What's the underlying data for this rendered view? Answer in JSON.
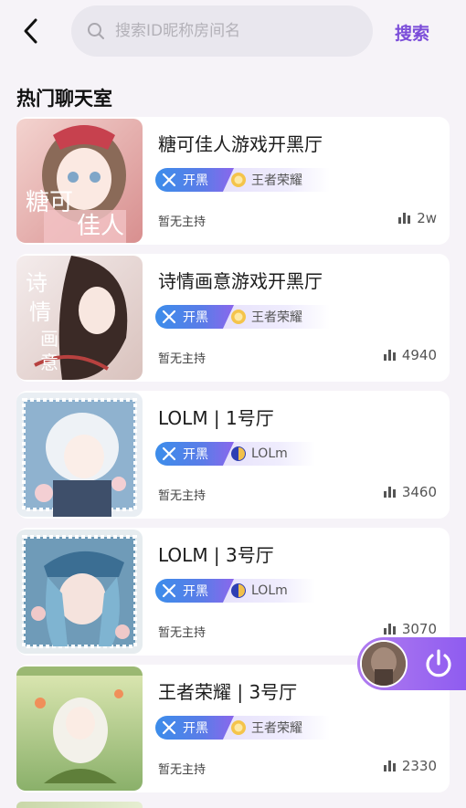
{
  "header": {
    "search_placeholder": "搜索ID昵称房间名",
    "search_button": "搜索"
  },
  "section_title": "热门聊天室",
  "rooms": [
    {
      "name": "糖可佳人游戏开黑厅",
      "tag_type": "开黑",
      "game": "王者荣耀",
      "game_icon": "honor-of-kings-icon",
      "host": "暂无主持",
      "count": "2w",
      "thumb_text": [
        "糖可",
        "佳人"
      ]
    },
    {
      "name": "诗情画意游戏开黑厅",
      "tag_type": "开黑",
      "game": "王者荣耀",
      "game_icon": "honor-of-kings-icon",
      "host": "暂无主持",
      "count": "4940",
      "thumb_text": [
        "诗",
        "情",
        "画",
        "意"
      ]
    },
    {
      "name": "LOLM | 1号厅",
      "tag_type": "开黑",
      "game": "LOLm",
      "game_icon": "lolm-icon",
      "host": "暂无主持",
      "count": "3460"
    },
    {
      "name": "LOLM | 3号厅",
      "tag_type": "开黑",
      "game": "LOLm",
      "game_icon": "lolm-icon",
      "host": "暂无主持",
      "count": "3070"
    },
    {
      "name": "王者荣耀 | 3号厅",
      "tag_type": "开黑",
      "game": "王者荣耀",
      "game_icon": "honor-of-kings-icon",
      "host": "暂无主持",
      "count": "2330"
    }
  ],
  "colors": {
    "accent": "#7b4dd9",
    "tag_gradient_start": "#3c8dea",
    "tag_gradient_end": "#8a67ec",
    "background": "#f6f3f8",
    "card": "#ffffff"
  },
  "icons": {
    "back": "chevron-left-icon",
    "search": "search-icon",
    "tag": "crossed-swords-icon",
    "count": "bar-chart-icon",
    "float": "power-icon"
  }
}
